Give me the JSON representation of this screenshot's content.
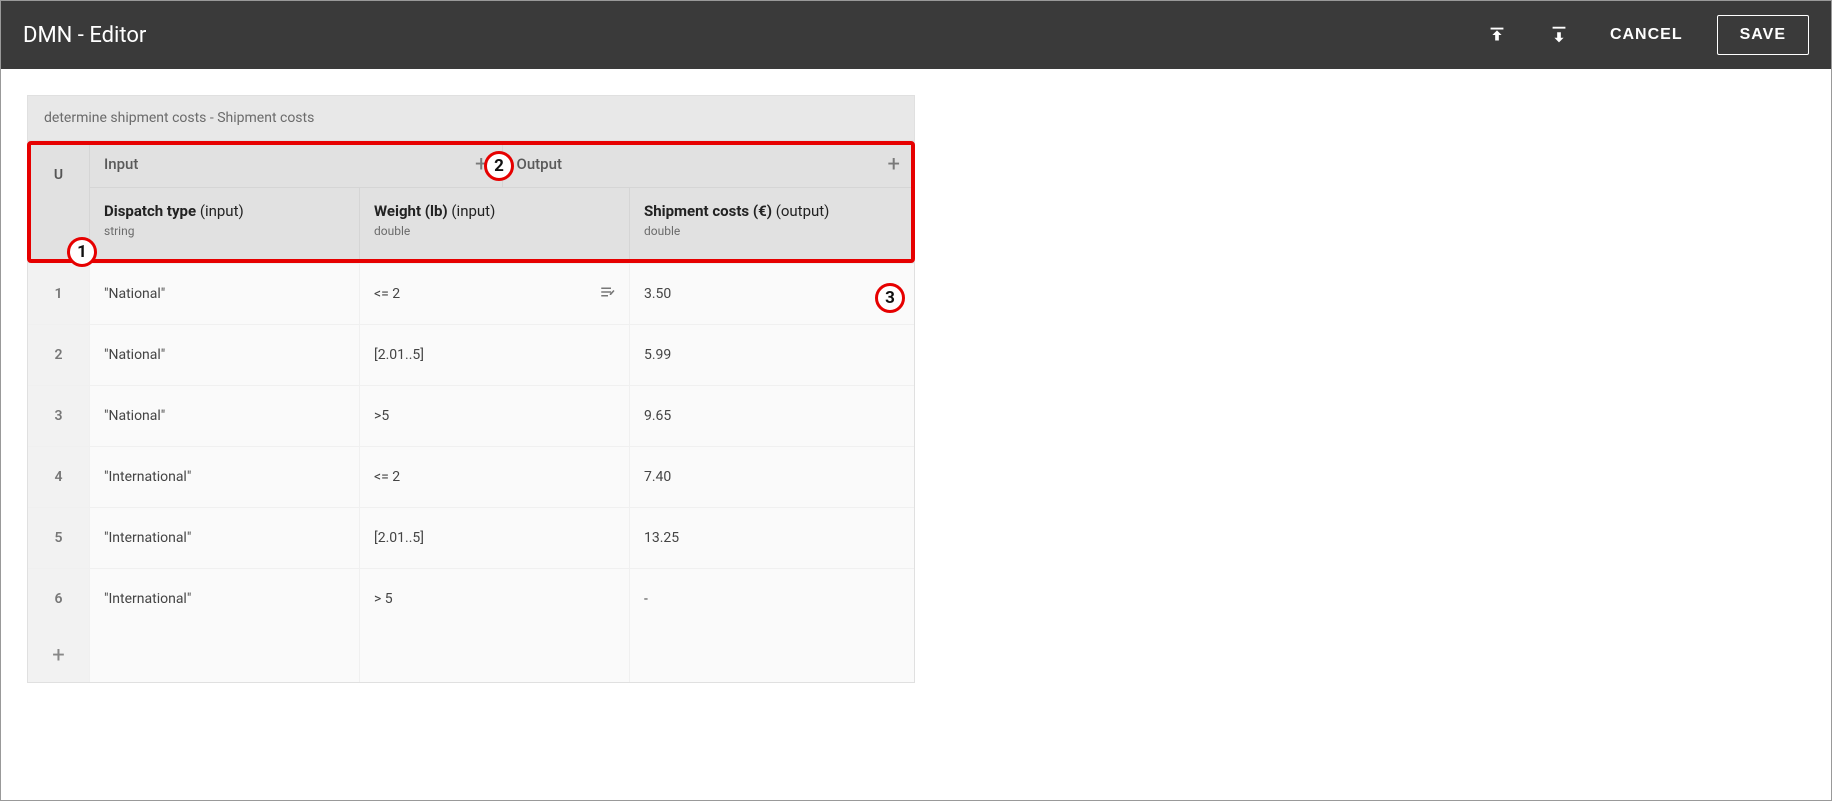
{
  "header": {
    "title": "DMN - Editor",
    "cancel": "CANCEL",
    "save": "SAVE"
  },
  "decision_title": "determine shipment costs - Shipment costs",
  "hit_policy": "U",
  "io": {
    "input_label": "Input",
    "output_label": "Output"
  },
  "columns": {
    "in1_name": "Dispatch type",
    "in1_role": "(input)",
    "in1_type": "string",
    "in2_name": "Weight (lb)",
    "in2_role": "(input)",
    "in2_type": "double",
    "out_name": "Shipment costs (€)",
    "out_role": "(output)",
    "out_type": "double"
  },
  "rows": [
    {
      "idx": "1",
      "in1": "\"National\"",
      "in2": "<= 2",
      "out": "3.50"
    },
    {
      "idx": "2",
      "in1": "\"National\"",
      "in2": "[2.01..5]",
      "out": "5.99"
    },
    {
      "idx": "3",
      "in1": "\"National\"",
      "in2": ">5",
      "out": "9.65"
    },
    {
      "idx": "4",
      "in1": "\"International\"",
      "in2": "<= 2",
      "out": "7.40"
    },
    {
      "idx": "5",
      "in1": "\"International\"",
      "in2": "[2.01..5]",
      "out": "13.25"
    },
    {
      "idx": "6",
      "in1": "\"International\"",
      "in2": "> 5",
      "out": "-"
    }
  ],
  "callouts": {
    "c1": "1",
    "c2": "2",
    "c3": "3"
  }
}
